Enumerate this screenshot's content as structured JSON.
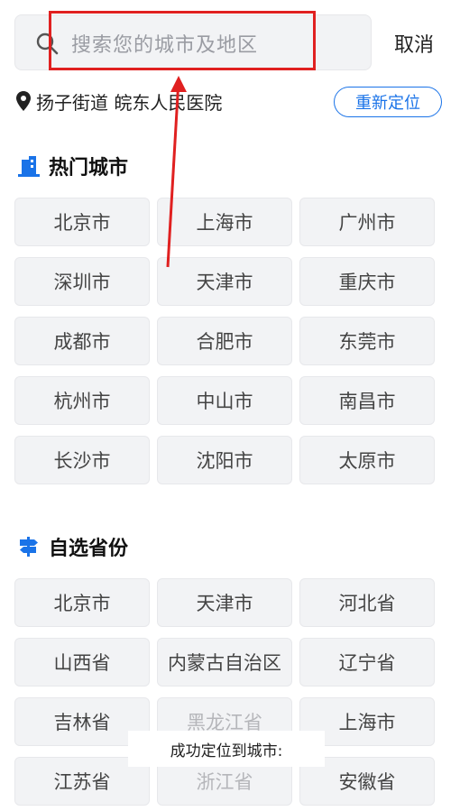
{
  "search": {
    "placeholder": "搜索您的城市及地区",
    "cancel_label": "取消"
  },
  "location": {
    "text": "扬子街道 皖东人民医院",
    "relocate_label": "重新定位"
  },
  "hot_cities": {
    "title": "热门城市",
    "items": [
      "北京市",
      "上海市",
      "广州市",
      "深圳市",
      "天津市",
      "重庆市",
      "成都市",
      "合肥市",
      "东莞市",
      "杭州市",
      "中山市",
      "南昌市",
      "长沙市",
      "沈阳市",
      "太原市"
    ]
  },
  "provinces": {
    "title": "自选省份",
    "items": [
      "北京市",
      "天津市",
      "河北省",
      "山西省",
      "内蒙古自治区",
      "辽宁省",
      "吉林省",
      "黑龙江省",
      "上海市",
      "江苏省",
      "浙江省",
      "安徽省"
    ]
  },
  "toast": {
    "text": "成功定位到城市:"
  },
  "colors": {
    "accent": "#1a73e8",
    "highlight": "#e02020"
  },
  "icons": {
    "search": "search-icon",
    "pin": "location-pin-icon",
    "hot": "building-icon",
    "province": "signpost-icon"
  }
}
